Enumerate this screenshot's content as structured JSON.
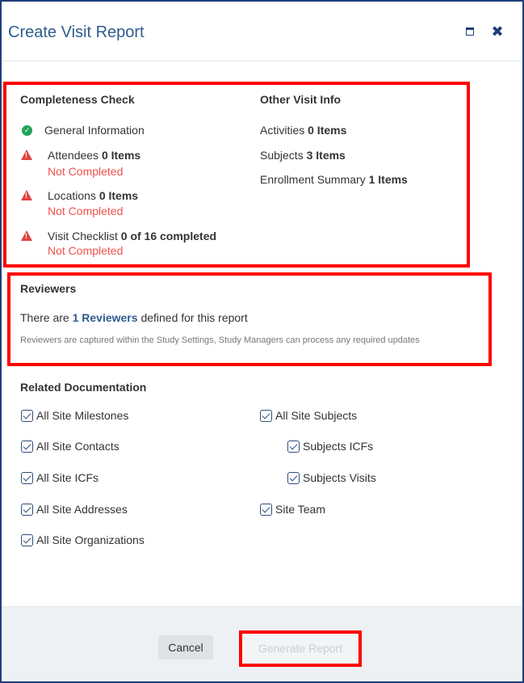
{
  "dialog": {
    "title": "Create Visit Report",
    "icons": {
      "maximize": "maximize-icon",
      "close": "close-icon"
    }
  },
  "completeness": {
    "heading": "Completeness Check",
    "items": [
      {
        "label": "General Information",
        "count": "",
        "status": "ok",
        "note": ""
      },
      {
        "label": "Attendees",
        "count": "0 Items",
        "status": "warning",
        "note": "Not Completed"
      },
      {
        "label": "Locations",
        "count": "0 Items",
        "status": "warning",
        "note": "Not Completed"
      },
      {
        "label": "Visit Checklist",
        "count": "0 of 16 completed",
        "status": "warning",
        "note": "Not Completed"
      }
    ]
  },
  "other_info": {
    "heading": "Other Visit Info",
    "items": [
      {
        "label": "Activities",
        "count": "0 Items"
      },
      {
        "label": "Subjects",
        "count": "3 Items"
      },
      {
        "label": "Enrollment Summary",
        "count": "1 Items"
      }
    ]
  },
  "reviewers": {
    "heading": "Reviewers",
    "text_prefix": "There are",
    "link": "1 Reviewers",
    "text_suffix": "defined for this report",
    "note": "Reviewers are captured within the Study Settings, Study Managers can process any required updates"
  },
  "related_docs": {
    "heading": "Related Documentation",
    "items": [
      {
        "label": "All Site Milestones",
        "checked": true
      },
      {
        "label": "All Site Contacts",
        "checked": true
      },
      {
        "label": "All Site ICFs",
        "checked": true
      },
      {
        "label": "All Site Addresses",
        "checked": true
      },
      {
        "label": "All Site Organizations",
        "checked": true
      },
      {
        "label": "All Site Subjects",
        "checked": true
      },
      {
        "label": "Subjects ICFs",
        "checked": true
      },
      {
        "label": "Subjects Visits",
        "checked": true
      },
      {
        "label": "Site Team",
        "checked": true
      }
    ]
  },
  "footer": {
    "cancel_label": "Cancel",
    "generate_label": "Generate Report"
  },
  "colors": {
    "highlight": "#ff0000",
    "title": "#2f5c8c",
    "ok": "#21a35b",
    "warning": "#e0433f",
    "not_completed": "#f0504c"
  }
}
